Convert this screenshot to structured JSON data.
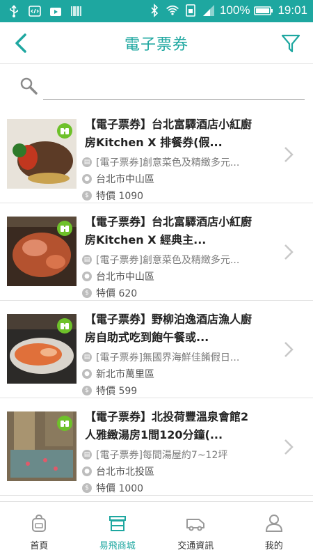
{
  "status": {
    "battery": "100%",
    "time": "19:01"
  },
  "header": {
    "title": "電子票券"
  },
  "search": {
    "placeholder": ""
  },
  "items": [
    {
      "name": "【電子票券】台北富驛酒店小紅廚房Kitchen X 排餐券(假...",
      "desc": "[電子票券]創意菜色及精緻多元...",
      "location": "台北市中山區",
      "price": "特價 1090"
    },
    {
      "name": "【電子票券】台北富驛酒店小紅廚房Kitchen X 經典主...",
      "desc": "[電子票券]創意菜色及精緻多元...",
      "location": "台北市中山區",
      "price": "特價 620"
    },
    {
      "name": "【電子票券】野柳泊逸酒店漁人廚房自助式吃到飽午餐或...",
      "desc": "[電子票券]無國界海鮮佳餚假日...",
      "location": "新北市萬里區",
      "price": "特價 599"
    },
    {
      "name": "【電子票券】北投荷豐溫泉會館2人雅緻湯房1間120分鐘(...",
      "desc": "[電子票券]每間湯屋約7~12坪",
      "location": "台北市北投區",
      "price": "特價 1000"
    }
  ],
  "nav": {
    "tabs": [
      {
        "label": "首頁",
        "icon": "backpack-icon"
      },
      {
        "label": "易飛商城",
        "icon": "store-icon"
      },
      {
        "label": "交通資訊",
        "icon": "van-icon"
      },
      {
        "label": "我的",
        "icon": "person-icon"
      }
    ],
    "active_index": 1
  },
  "colors": {
    "accent": "#1ea7a0",
    "badge": "#6ec12a"
  }
}
